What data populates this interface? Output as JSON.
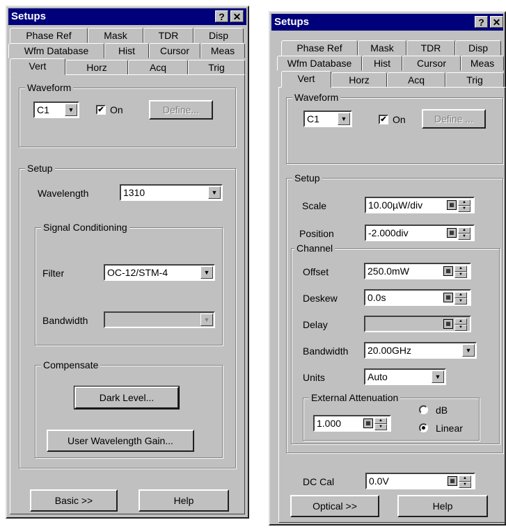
{
  "left": {
    "title": "Setups",
    "tabs_row1": [
      "Phase Ref",
      "Mask",
      "TDR",
      "Disp"
    ],
    "tabs_row2": [
      "Wfm Database",
      "Hist",
      "Cursor",
      "Meas"
    ],
    "tabs_row3": [
      "Vert",
      "Horz",
      "Acq",
      "Trig"
    ],
    "waveform": {
      "group": "Waveform",
      "source": "C1",
      "on_label": "On",
      "define_label": "Define..."
    },
    "setup": {
      "group": "Setup",
      "wavelength_label": "Wavelength",
      "wavelength_value": "1310",
      "signal_group": "Signal Conditioning",
      "filter_label": "Filter",
      "filter_value": "OC-12/STM-4",
      "bandwidth_label": "Bandwidth",
      "bandwidth_value": "",
      "compensate_group": "Compensate",
      "dark_level": "Dark Level...",
      "user_gain": "User Wavelength Gain..."
    },
    "basic_button": "Basic >>",
    "help_button": "Help"
  },
  "right": {
    "title": "Setups",
    "tabs_row1": [
      "Phase Ref",
      "Mask",
      "TDR",
      "Disp"
    ],
    "tabs_row2": [
      "Wfm Database",
      "Hist",
      "Cursor",
      "Meas"
    ],
    "tabs_row3": [
      "Vert",
      "Horz",
      "Acq",
      "Trig"
    ],
    "waveform": {
      "group": "Waveform",
      "source": "C1",
      "on_label": "On",
      "define_label": "Define ..."
    },
    "setup": {
      "group": "Setup",
      "scale_label": "Scale",
      "scale_value": "10.00µW/div",
      "position_label": "Position",
      "position_value": "-2.000div",
      "channel_group": "Channel",
      "offset_label": "Offset",
      "offset_value": "250.0mW",
      "deskew_label": "Deskew",
      "deskew_value": "0.0s",
      "delay_label": "Delay",
      "delay_value": "",
      "bandwidth_label": "Bandwidth",
      "bandwidth_value": "20.00GHz",
      "units_label": "Units",
      "units_value": "Auto",
      "ext_group": "External Attenuation",
      "ext_value": "1.000",
      "db_label": "dB",
      "linear_label": "Linear",
      "dccal_label": "DC Cal",
      "dccal_value": "0.0V"
    },
    "optical_button": "Optical >>",
    "help_button": "Help"
  },
  "icons": {
    "help": "?",
    "close": "✕",
    "dropdown": "▼",
    "check": "✔",
    "keypad": "▦",
    "up": "▲",
    "down": "▼"
  }
}
